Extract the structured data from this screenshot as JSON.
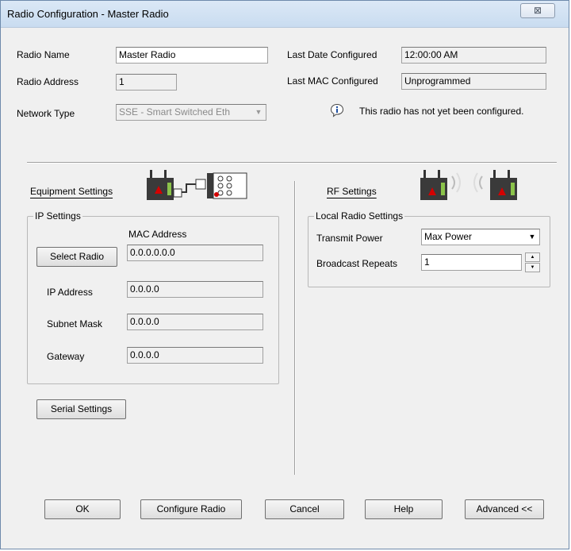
{
  "window": {
    "title": "Radio Configuration - Master Radio",
    "close_glyph": "⊠"
  },
  "identity": {
    "radio_name_label": "Radio Name",
    "radio_name_value": "Master Radio",
    "radio_address_label": "Radio Address",
    "radio_address_value": "1",
    "network_type_label": "Network Type",
    "network_type_value": "SSE - Smart Switched Eth"
  },
  "status": {
    "last_date_label": "Last Date Configured",
    "last_date_value": "12:00:00 AM",
    "last_mac_label": "Last MAC Configured",
    "last_mac_value": "Unprogrammed",
    "info_icon": "info-icon",
    "info_message": "This radio has not yet been configured."
  },
  "equipment": {
    "heading": "Equipment Settings",
    "ip_group_label": "IP Settings",
    "mac_address_label": "MAC Address",
    "select_radio_button": "Select Radio",
    "mac_address_value": "0.0.0.0.0.0",
    "ip_address_label": "IP Address",
    "ip_address_value": "0.0.0.0",
    "subnet_mask_label": "Subnet Mask",
    "subnet_mask_value": "0.0.0.0",
    "gateway_label": "Gateway",
    "gateway_value": "0.0.0.0",
    "serial_settings_button": "Serial Settings"
  },
  "rf": {
    "heading": "RF Settings",
    "local_group_label": "Local Radio Settings",
    "transmit_power_label": "Transmit Power",
    "transmit_power_value": "Max Power",
    "broadcast_repeats_label": "Broadcast Repeats",
    "broadcast_repeats_value": "1"
  },
  "footer": {
    "ok": "OK",
    "configure_radio": "Configure Radio",
    "cancel": "Cancel",
    "help": "Help",
    "advanced": "Advanced <<"
  },
  "colors": {
    "accent_red": "#d40000",
    "device_dark": "#3a3a3a",
    "info_blue": "#1f4fa0"
  }
}
